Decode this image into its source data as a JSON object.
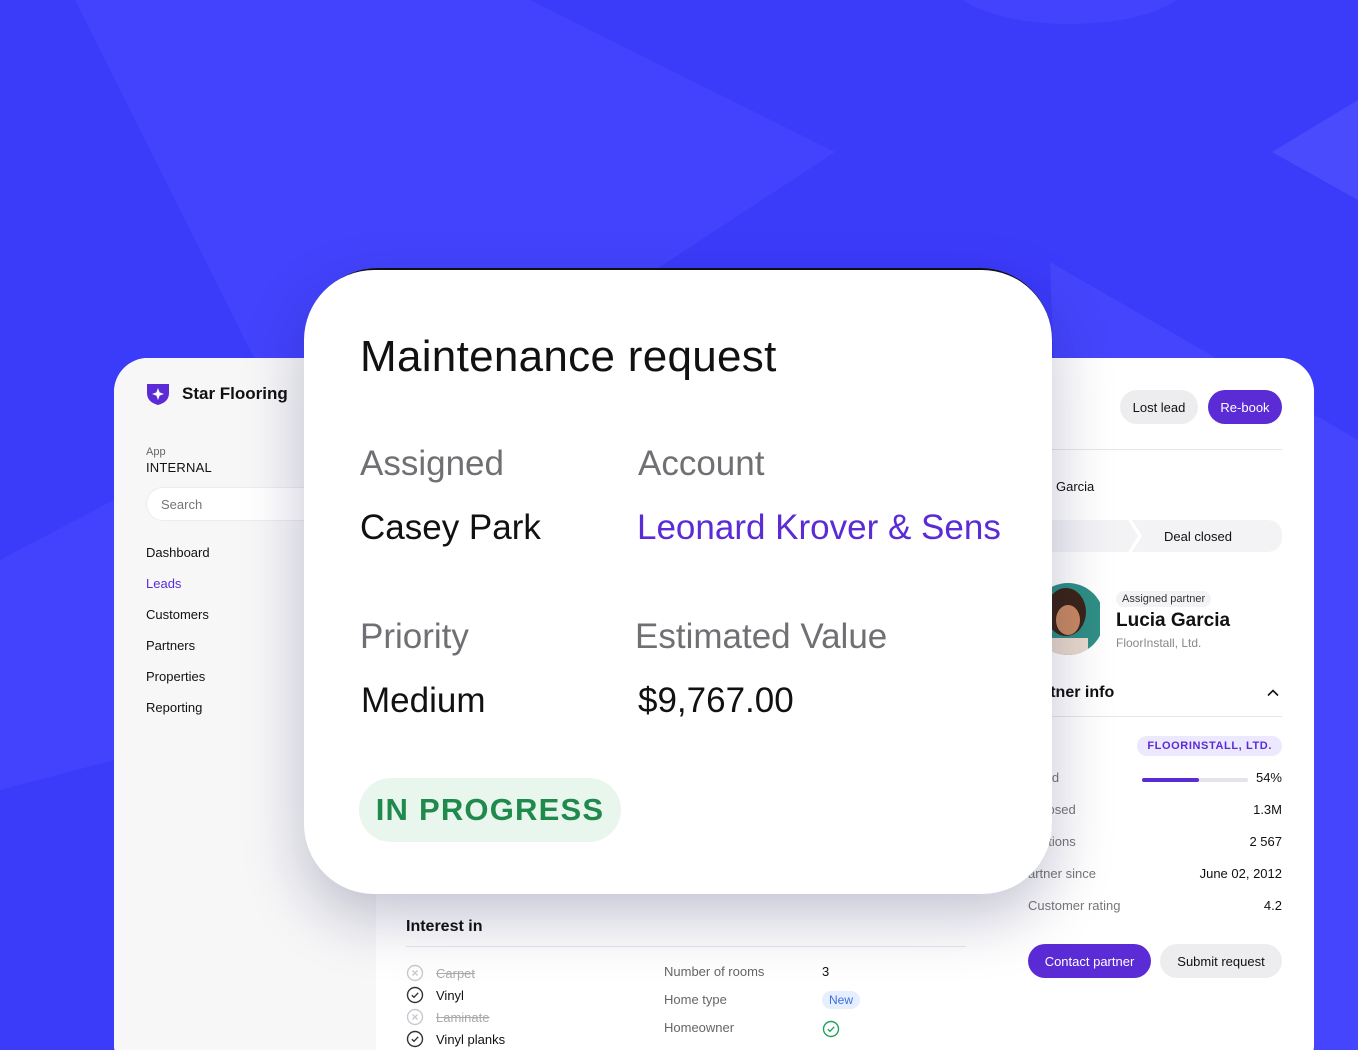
{
  "brand": {
    "name": "Star Flooring"
  },
  "app": {
    "label": "App",
    "value": "INTERNAL"
  },
  "search": {
    "placeholder": "Search"
  },
  "nav": [
    "Dashboard",
    "Leads",
    "Customers",
    "Partners",
    "Properties",
    "Reporting"
  ],
  "nav_active": "Leads",
  "header_actions": {
    "lost_lead": "Lost lead",
    "rebook": "Re-book"
  },
  "lead": {
    "name_partial": "Garcia",
    "stage": "Deal closed"
  },
  "partner": {
    "assigned_label": "Assigned partner",
    "name": "Lucia Garcia",
    "company": "FloorInstall, Ltd.",
    "info_title": "rtner info",
    "stats": {
      "name_label": "e",
      "company_badge": "FLOORINSTALL, LTD.",
      "workload_label": "kload",
      "workload_value": "54%",
      "workload_fraction": 0.54,
      "closed_label": "s closed",
      "closed_value": "1.3M",
      "installations_label": "allations",
      "installations_value": "2 567",
      "since_label": "artner since",
      "since_value": "June 02, 2012",
      "rating_label": "Customer rating",
      "rating_value": "4.2"
    },
    "contact": "Contact partner",
    "submit": "Submit request"
  },
  "interest": {
    "title": "Interest in",
    "items": [
      {
        "label": "Carpet",
        "checked": false
      },
      {
        "label": "Vinyl",
        "checked": true
      },
      {
        "label": "Laminate",
        "checked": false
      },
      {
        "label": "Vinyl planks",
        "checked": true
      }
    ]
  },
  "facts": {
    "rooms_label": "Number of rooms",
    "rooms_value": "3",
    "home_label": "Home type",
    "home_value": "New",
    "owner_label": "Homeowner"
  },
  "card": {
    "title": "Maintenance request",
    "assigned_label": "Assigned",
    "assigned_value": "Casey Park",
    "account_label": "Account",
    "account_value": "Leonard Krover & Sens",
    "priority_label": "Priority",
    "priority_value": "Medium",
    "value_label": "Estimated Value",
    "value_value": "$9,767.00",
    "status": "IN PROGRESS"
  },
  "colors": {
    "background": "#3b3bfa",
    "accent": "#5b2bd6",
    "status_green": "#1f8a4c",
    "status_bg": "#e8f6ee"
  }
}
